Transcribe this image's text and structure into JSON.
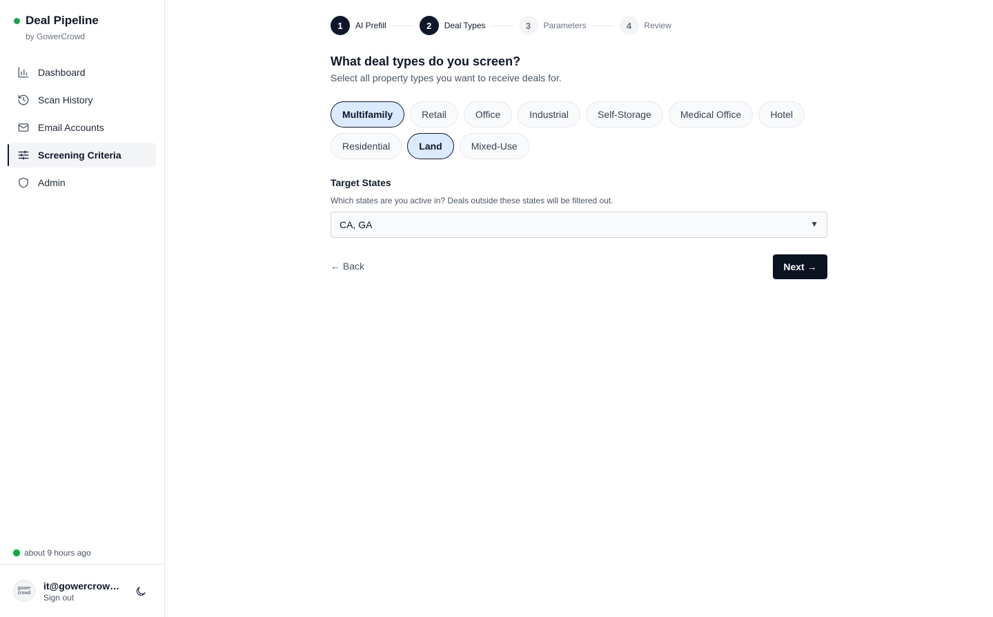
{
  "app": {
    "title": "Deal Pipeline",
    "subtitle": "by GowerCrowd"
  },
  "sidebar": {
    "items": [
      {
        "label": "Dashboard",
        "icon": "bar-chart-icon",
        "active": false
      },
      {
        "label": "Scan History",
        "icon": "history-icon",
        "active": false
      },
      {
        "label": "Email Accounts",
        "icon": "mail-icon",
        "active": false
      },
      {
        "label": "Screening Criteria",
        "icon": "sliders-icon",
        "active": true
      },
      {
        "label": "Admin",
        "icon": "shield-icon",
        "active": false
      }
    ],
    "sync_status": "about 9 hours ago",
    "user": {
      "email": "it@gowercrowd.com",
      "sign_out": "Sign out",
      "avatar_text": "gower crowd"
    }
  },
  "stepper": {
    "steps": [
      {
        "number": "1",
        "label": "AI Prefill",
        "state": "done"
      },
      {
        "number": "2",
        "label": "Deal Types",
        "state": "current"
      },
      {
        "number": "3",
        "label": "Parameters",
        "state": "todo"
      },
      {
        "number": "4",
        "label": "Review",
        "state": "todo"
      }
    ]
  },
  "main": {
    "heading": "What deal types do you screen?",
    "subheading": "Select all property types you want to receive deals for.",
    "deal_types": [
      {
        "label": "Multifamily",
        "selected": true
      },
      {
        "label": "Retail",
        "selected": false
      },
      {
        "label": "Office",
        "selected": false
      },
      {
        "label": "Industrial",
        "selected": false
      },
      {
        "label": "Self-Storage",
        "selected": false
      },
      {
        "label": "Medical Office",
        "selected": false
      },
      {
        "label": "Hotel",
        "selected": false
      },
      {
        "label": "Residential",
        "selected": false
      },
      {
        "label": "Land",
        "selected": true
      },
      {
        "label": "Mixed-Use",
        "selected": false
      }
    ],
    "target_states": {
      "title": "Target States",
      "help": "Which states are you active in? Deals outside these states will be filtered out.",
      "value": "CA, GA",
      "arrow": "▼"
    },
    "back_label": "← Back",
    "next_label": "Next →"
  },
  "colors": {
    "primary": "#0f172a",
    "selected_chip_bg": "#dbeafe",
    "status_green": "#16a34a"
  }
}
